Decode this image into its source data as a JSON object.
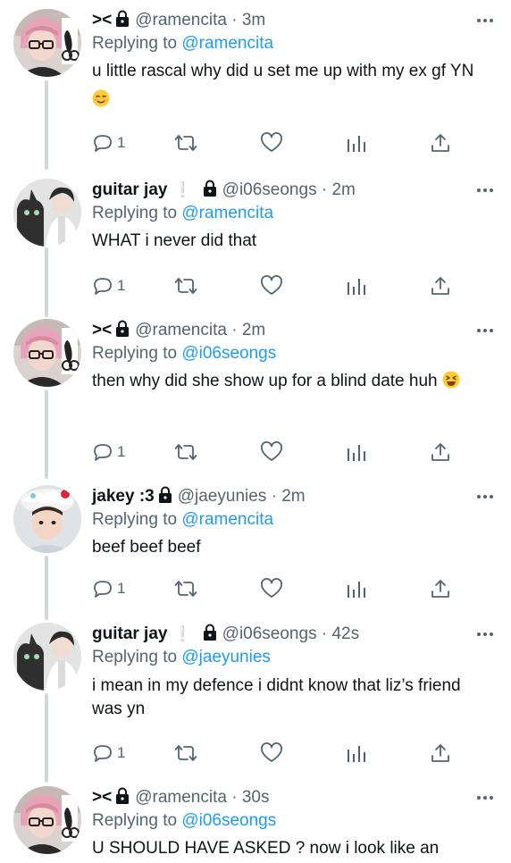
{
  "tweets": [
    {
      "display_name": "><",
      "handle": "@ramencita",
      "separator": "·",
      "time": "3m",
      "replying_prefix": "Replying to",
      "replying_to": "@ramencita",
      "body": "u little rascal why did u set me up with my ex gf YN",
      "emoji": "relieved-face",
      "reply_count": "1",
      "avatar": "pink-hair-glasses-avatar"
    },
    {
      "display_name": "guitar jay",
      "verified_mark": "❕",
      "handle": "@i06seongs",
      "separator": "·",
      "time": "2m",
      "replying_prefix": "Replying to",
      "replying_to": "@ramencita",
      "body": "WHAT i never did that",
      "reply_count": "1",
      "avatar": "black-cat-boy-avatar"
    },
    {
      "display_name": "><",
      "handle": "@ramencita",
      "separator": "·",
      "time": "2m",
      "replying_prefix": "Replying to",
      "replying_to": "@i06seongs",
      "body": "then why did she show up for a blind date huh",
      "emoji": "laughing-face",
      "reply_count": "1",
      "avatar": "pink-hair-glasses-avatar"
    },
    {
      "display_name": "jakey :3",
      "handle": "@jaeyunies",
      "separator": "·",
      "time": "2m",
      "replying_prefix": "Replying to",
      "replying_to": "@ramencita",
      "body": "beef beef beef",
      "reply_count": "1",
      "avatar": "cake-hat-boy-avatar"
    },
    {
      "display_name": "guitar jay",
      "verified_mark": "❕",
      "handle": "@i06seongs",
      "separator": "·",
      "time": "42s",
      "replying_prefix": "Replying to",
      "replying_to": "@jaeyunies",
      "body": "i mean in my defence i didnt know that liz’s friend was yn",
      "reply_count": "1",
      "avatar": "black-cat-boy-avatar"
    },
    {
      "display_name": "><",
      "handle": "@ramencita",
      "separator": "·",
      "time": "30s",
      "replying_prefix": "Replying to",
      "replying_to": "@i06seongs",
      "body": "U SHOULD HAVE ASKED ? now i look like an",
      "avatar": "pink-hair-glasses-avatar"
    }
  ],
  "colors": {
    "link": "#1d9bf0",
    "muted": "#536471",
    "thread_line": "#cfd9de"
  },
  "icons": [
    "lock-icon",
    "more-icon",
    "reply-icon",
    "retweet-icon",
    "like-icon",
    "analytics-icon",
    "share-icon"
  ]
}
